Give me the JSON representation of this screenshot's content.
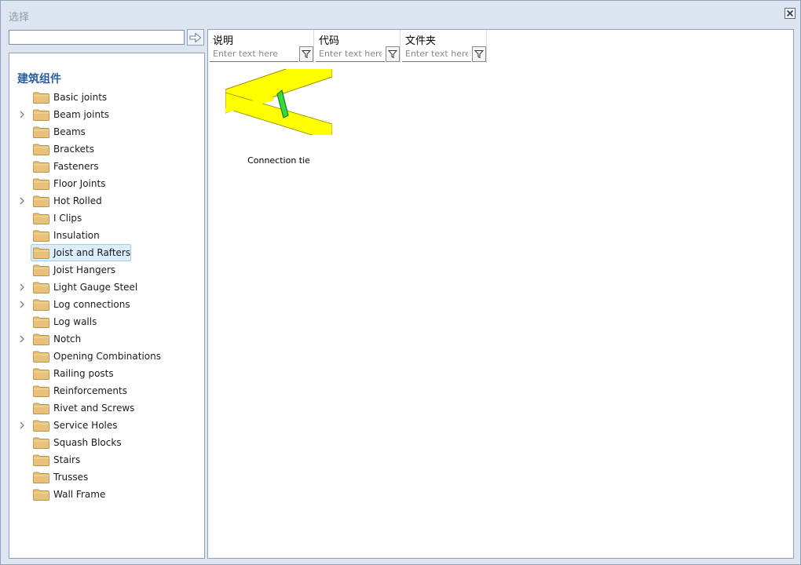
{
  "window": {
    "title": "选择"
  },
  "search": {
    "value": "",
    "placeholder": ""
  },
  "tree": {
    "root_label": "建筑组件",
    "items": [
      {
        "label": "Basic joints",
        "expandable": false,
        "selected": false
      },
      {
        "label": "Beam joints",
        "expandable": true,
        "selected": false
      },
      {
        "label": "Beams",
        "expandable": false,
        "selected": false
      },
      {
        "label": "Brackets",
        "expandable": false,
        "selected": false
      },
      {
        "label": "Fasteners",
        "expandable": false,
        "selected": false
      },
      {
        "label": "Floor Joints",
        "expandable": false,
        "selected": false
      },
      {
        "label": "Hot Rolled",
        "expandable": true,
        "selected": false
      },
      {
        "label": "I Clips",
        "expandable": false,
        "selected": false
      },
      {
        "label": "Insulation",
        "expandable": false,
        "selected": false
      },
      {
        "label": "Joist and Rafters",
        "expandable": false,
        "selected": true
      },
      {
        "label": "Joist Hangers",
        "expandable": false,
        "selected": false
      },
      {
        "label": "Light Gauge Steel",
        "expandable": true,
        "selected": false
      },
      {
        "label": "Log connections",
        "expandable": true,
        "selected": false
      },
      {
        "label": "Log walls",
        "expandable": false,
        "selected": false
      },
      {
        "label": "Notch",
        "expandable": true,
        "selected": false
      },
      {
        "label": "Opening Combinations",
        "expandable": false,
        "selected": false
      },
      {
        "label": "Railing posts",
        "expandable": false,
        "selected": false
      },
      {
        "label": "Reinforcements",
        "expandable": false,
        "selected": false
      },
      {
        "label": "Rivet and Screws",
        "expandable": false,
        "selected": false
      },
      {
        "label": "Service Holes",
        "expandable": true,
        "selected": false
      },
      {
        "label": "Squash Blocks",
        "expandable": false,
        "selected": false
      },
      {
        "label": "Stairs",
        "expandable": false,
        "selected": false
      },
      {
        "label": "Trusses",
        "expandable": false,
        "selected": false
      },
      {
        "label": "Wall Frame",
        "expandable": false,
        "selected": false
      }
    ]
  },
  "columns": [
    {
      "title": "说明",
      "filter_placeholder": "Enter text here"
    },
    {
      "title": "代码",
      "filter_placeholder": "Enter text here"
    },
    {
      "title": "文件夹",
      "filter_placeholder": "Enter text here"
    }
  ],
  "results": [
    {
      "label": "Connection tie"
    }
  ],
  "colors": {
    "accent_title": "#2a5f9e",
    "folder": "#e8c27a",
    "selection": "#dbeefc",
    "beam": "#ffff00",
    "tie": "#33dd33"
  }
}
